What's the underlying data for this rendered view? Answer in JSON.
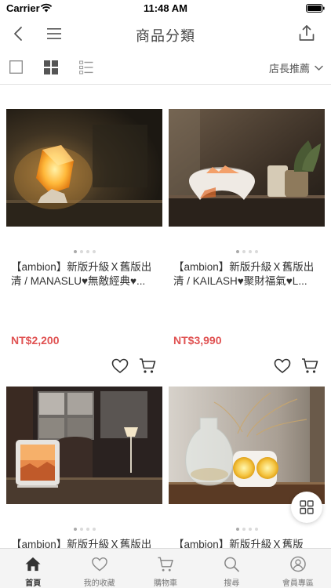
{
  "status_bar": {
    "carrier": "Carrier",
    "time": "11:48 AM"
  },
  "nav": {
    "title": "商品分類"
  },
  "toolbar": {
    "sort_label": "店長推薦"
  },
  "products": [
    {
      "title": "【ambion】新版升級Ｘ舊版出清 / MANASLU♥無敵經典♥...",
      "price": "NT$2,200"
    },
    {
      "title": "【ambion】新版升級Ｘ舊版出清 / KAILASH♥聚財福氣♥L...",
      "price": "NT$3,990"
    },
    {
      "title": "【ambion】新版升級Ｘ舊版出",
      "price": ""
    },
    {
      "title": "【ambion】新版升級Ｘ舊版",
      "price": ""
    }
  ],
  "tab_bar": {
    "home": "首頁",
    "favorites": "我的收藏",
    "cart": "購物車",
    "search": "搜尋",
    "member": "會員專區"
  },
  "colors": {
    "price": "#e05252",
    "accent": "#333333"
  }
}
